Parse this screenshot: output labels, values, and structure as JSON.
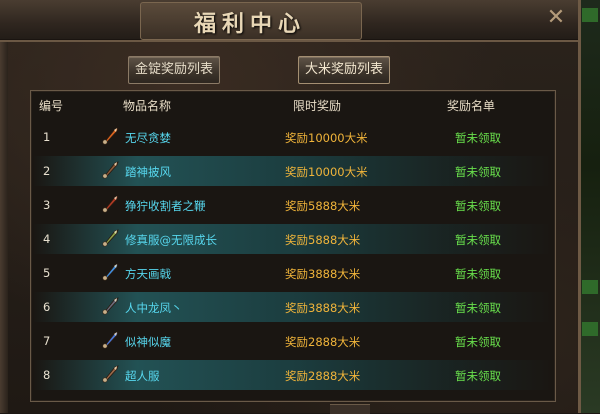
{
  "window": {
    "title": "福利中心",
    "close_glyph": "✕"
  },
  "tabs": [
    {
      "label": "金锭奖励列表"
    },
    {
      "label": "大米奖励列表"
    }
  ],
  "table": {
    "headers": {
      "no": "编号",
      "name": "物品名称",
      "reward": "限时奖励",
      "status": "奖励名单"
    },
    "rows": [
      {
        "no": "1",
        "name": "无尽贪婪",
        "reward": "奖励10000大米",
        "status": "暂未领取",
        "icon": "flame-blade-icon",
        "icon_color": "#d9631e"
      },
      {
        "no": "2",
        "name": "踏神披风",
        "reward": "奖励10000大米",
        "status": "暂未领取",
        "icon": "cloak-armor-icon",
        "icon_color": "#8a5a3a"
      },
      {
        "no": "3",
        "name": "狰狞收割者之鞭",
        "reward": "奖励5888大米",
        "status": "暂未领取",
        "icon": "whip-axe-icon",
        "icon_color": "#b03a24"
      },
      {
        "no": "4",
        "name": "修真服@无限成长",
        "reward": "奖励5888大米",
        "status": "暂未领取",
        "icon": "robe-armor-icon",
        "icon_color": "#8aa04a"
      },
      {
        "no": "5",
        "name": "方天画戟",
        "reward": "奖励3888大米",
        "status": "暂未领取",
        "icon": "halberd-icon",
        "icon_color": "#3f8fe0"
      },
      {
        "no": "6",
        "name": "人中龙凤丶",
        "reward": "奖励3888大米",
        "status": "暂未领取",
        "icon": "dragon-armor-icon",
        "icon_color": "#6a6a7a"
      },
      {
        "no": "7",
        "name": "似神似魔",
        "reward": "奖励2888大米",
        "status": "暂未领取",
        "icon": "blue-blade-icon",
        "icon_color": "#4a78d8"
      },
      {
        "no": "8",
        "name": "超人服",
        "reward": "奖励2888大米",
        "status": "暂未领取",
        "icon": "hero-armor-icon",
        "icon_color": "#9a6a4a"
      }
    ]
  }
}
